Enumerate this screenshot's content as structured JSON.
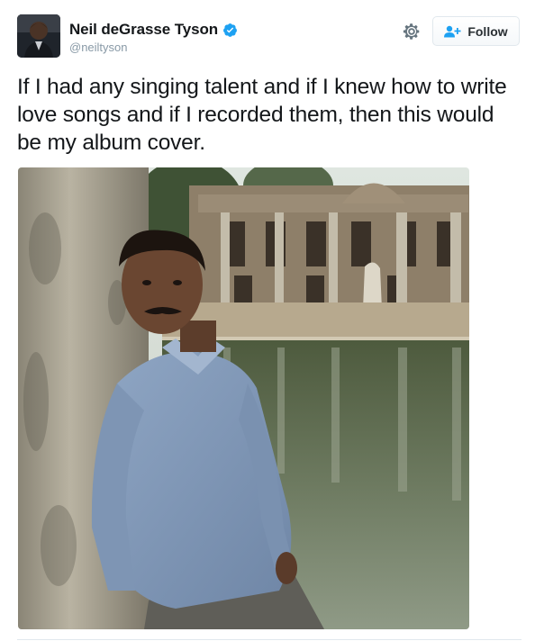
{
  "author": {
    "display_name": "Neil deGrasse Tyson",
    "handle": "@neiltyson",
    "verified": true,
    "avatar_icon": "profile-avatar"
  },
  "actions": {
    "settings_icon": "gear-icon",
    "follow_label": "Follow",
    "follow_icon": "add-user-icon"
  },
  "tweet": {
    "text": "If I had any singing talent and if I knew how to write love songs and if I recorded them, then this would be my album cover."
  },
  "colors": {
    "verified_blue": "#1da1f2",
    "follow_icon_blue": "#1da1f2",
    "secondary_text": "#8899a6",
    "border": "#e1e8ed"
  }
}
